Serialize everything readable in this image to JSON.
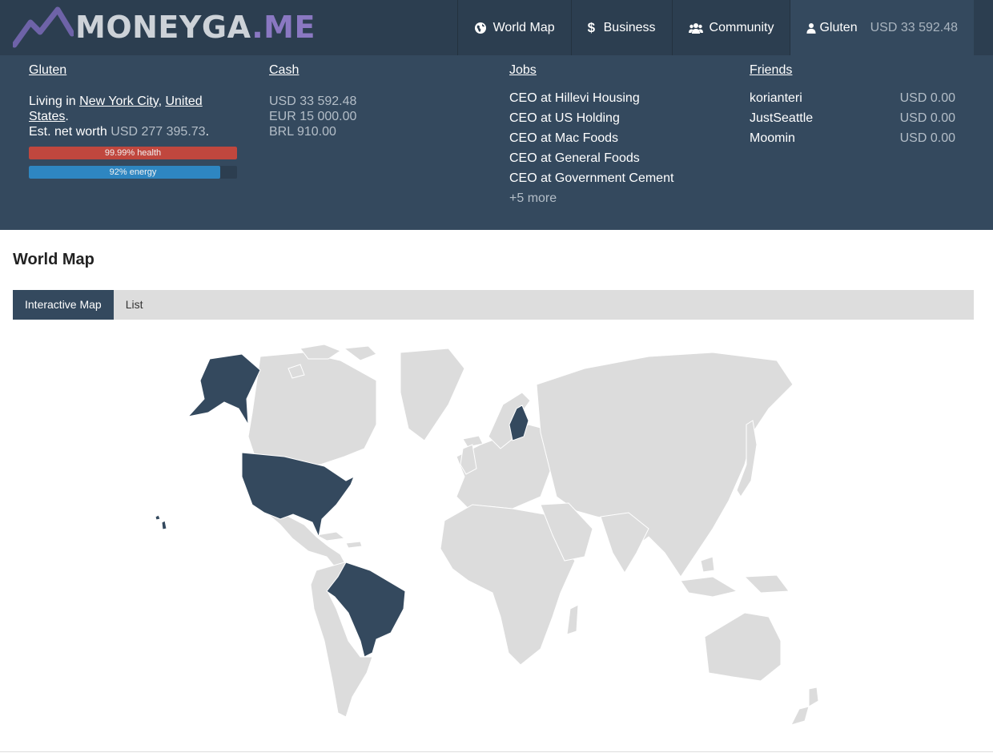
{
  "brand": {
    "part1": "MONEYGA",
    "part2": ".ME"
  },
  "nav": {
    "world_map": "World Map",
    "business": "Business",
    "community": "Community",
    "user": "Gluten",
    "user_cash": "USD 33 592.48"
  },
  "profile": {
    "heading": "Gluten",
    "living_prefix": "Living in ",
    "city": "New York City",
    "sep": ", ",
    "country": "United States",
    "period": ".",
    "networth_prefix": "Est. net worth ",
    "networth": "USD 277 395.73",
    "networth_suffix": ".",
    "health_label": "99.99% health",
    "health_value": 99.99,
    "energy_label": "92% energy",
    "energy_value": 92
  },
  "cash": {
    "heading": "Cash",
    "items": [
      "USD 33 592.48",
      "EUR 15 000.00",
      "BRL 910.00"
    ]
  },
  "jobs": {
    "heading": "Jobs",
    "items": [
      "CEO at Hillevi Housing",
      "CEO at US Holding",
      "CEO at Mac Foods",
      "CEO at General Foods",
      "CEO at Government Cement"
    ],
    "more": "+5 more"
  },
  "friends": {
    "heading": "Friends",
    "items": [
      {
        "name": "korianteri",
        "amount": "USD 0.00"
      },
      {
        "name": "JustSeattle",
        "amount": "USD 0.00"
      },
      {
        "name": "Moomin",
        "amount": "USD 0.00"
      }
    ]
  },
  "page": {
    "title": "World Map"
  },
  "tabs": {
    "interactive": "Interactive Map",
    "list": "List"
  },
  "colors": {
    "highlight": "#34495e",
    "land": "#dcdcdc",
    "health": "#c0473e",
    "energy": "#2e86c1"
  },
  "map": {
    "highlighted_countries": [
      "United States",
      "Brazil",
      "Finland"
    ]
  }
}
